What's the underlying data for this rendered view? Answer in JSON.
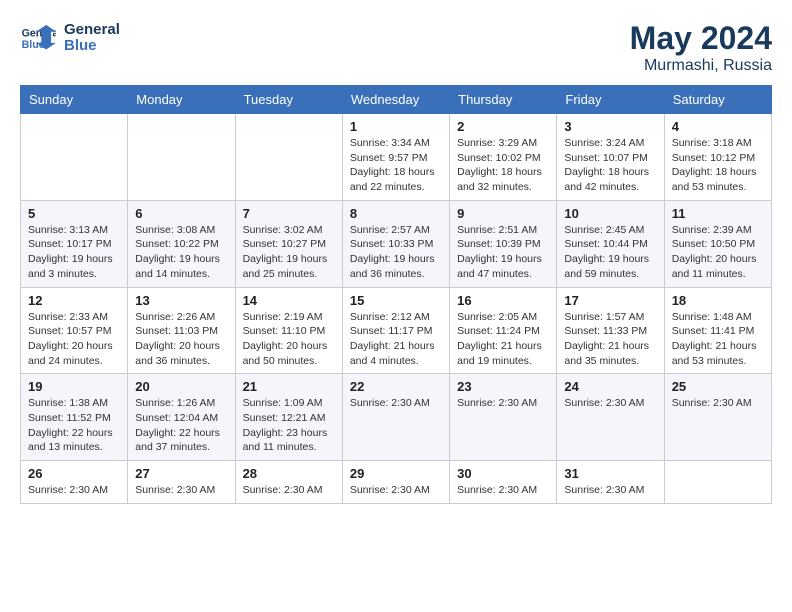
{
  "logo": {
    "text_general": "General",
    "text_blue": "Blue"
  },
  "title": {
    "month_year": "May 2024",
    "location": "Murmashi, Russia"
  },
  "days_of_week": [
    "Sunday",
    "Monday",
    "Tuesday",
    "Wednesday",
    "Thursday",
    "Friday",
    "Saturday"
  ],
  "weeks": [
    [
      {
        "day": "",
        "info": ""
      },
      {
        "day": "",
        "info": ""
      },
      {
        "day": "",
        "info": ""
      },
      {
        "day": "1",
        "info": "Sunrise: 3:34 AM\nSunset: 9:57 PM\nDaylight: 18 hours and 22 minutes."
      },
      {
        "day": "2",
        "info": "Sunrise: 3:29 AM\nSunset: 10:02 PM\nDaylight: 18 hours and 32 minutes."
      },
      {
        "day": "3",
        "info": "Sunrise: 3:24 AM\nSunset: 10:07 PM\nDaylight: 18 hours and 42 minutes."
      },
      {
        "day": "4",
        "info": "Sunrise: 3:18 AM\nSunset: 10:12 PM\nDaylight: 18 hours and 53 minutes."
      }
    ],
    [
      {
        "day": "5",
        "info": "Sunrise: 3:13 AM\nSunset: 10:17 PM\nDaylight: 19 hours and 3 minutes."
      },
      {
        "day": "6",
        "info": "Sunrise: 3:08 AM\nSunset: 10:22 PM\nDaylight: 19 hours and 14 minutes."
      },
      {
        "day": "7",
        "info": "Sunrise: 3:02 AM\nSunset: 10:27 PM\nDaylight: 19 hours and 25 minutes."
      },
      {
        "day": "8",
        "info": "Sunrise: 2:57 AM\nSunset: 10:33 PM\nDaylight: 19 hours and 36 minutes."
      },
      {
        "day": "9",
        "info": "Sunrise: 2:51 AM\nSunset: 10:39 PM\nDaylight: 19 hours and 47 minutes."
      },
      {
        "day": "10",
        "info": "Sunrise: 2:45 AM\nSunset: 10:44 PM\nDaylight: 19 hours and 59 minutes."
      },
      {
        "day": "11",
        "info": "Sunrise: 2:39 AM\nSunset: 10:50 PM\nDaylight: 20 hours and 11 minutes."
      }
    ],
    [
      {
        "day": "12",
        "info": "Sunrise: 2:33 AM\nSunset: 10:57 PM\nDaylight: 20 hours and 24 minutes."
      },
      {
        "day": "13",
        "info": "Sunrise: 2:26 AM\nSunset: 11:03 PM\nDaylight: 20 hours and 36 minutes."
      },
      {
        "day": "14",
        "info": "Sunrise: 2:19 AM\nSunset: 11:10 PM\nDaylight: 20 hours and 50 minutes."
      },
      {
        "day": "15",
        "info": "Sunrise: 2:12 AM\nSunset: 11:17 PM\nDaylight: 21 hours and 4 minutes."
      },
      {
        "day": "16",
        "info": "Sunrise: 2:05 AM\nSunset: 11:24 PM\nDaylight: 21 hours and 19 minutes."
      },
      {
        "day": "17",
        "info": "Sunrise: 1:57 AM\nSunset: 11:33 PM\nDaylight: 21 hours and 35 minutes."
      },
      {
        "day": "18",
        "info": "Sunrise: 1:48 AM\nSunset: 11:41 PM\nDaylight: 21 hours and 53 minutes."
      }
    ],
    [
      {
        "day": "19",
        "info": "Sunrise: 1:38 AM\nSunset: 11:52 PM\nDaylight: 22 hours and 13 minutes."
      },
      {
        "day": "20",
        "info": "Sunrise: 1:26 AM\nSunset: 12:04 AM\nDaylight: 22 hours and 37 minutes."
      },
      {
        "day": "21",
        "info": "Sunrise: 1:09 AM\nSunset: 12:21 AM\nDaylight: 23 hours and 11 minutes."
      },
      {
        "day": "22",
        "info": "Sunrise: 2:30 AM"
      },
      {
        "day": "23",
        "info": "Sunrise: 2:30 AM"
      },
      {
        "day": "24",
        "info": "Sunrise: 2:30 AM"
      },
      {
        "day": "25",
        "info": "Sunrise: 2:30 AM"
      }
    ],
    [
      {
        "day": "26",
        "info": "Sunrise: 2:30 AM"
      },
      {
        "day": "27",
        "info": "Sunrise: 2:30 AM"
      },
      {
        "day": "28",
        "info": "Sunrise: 2:30 AM"
      },
      {
        "day": "29",
        "info": "Sunrise: 2:30 AM"
      },
      {
        "day": "30",
        "info": "Sunrise: 2:30 AM"
      },
      {
        "day": "31",
        "info": "Sunrise: 2:30 AM"
      },
      {
        "day": "",
        "info": ""
      }
    ]
  ]
}
